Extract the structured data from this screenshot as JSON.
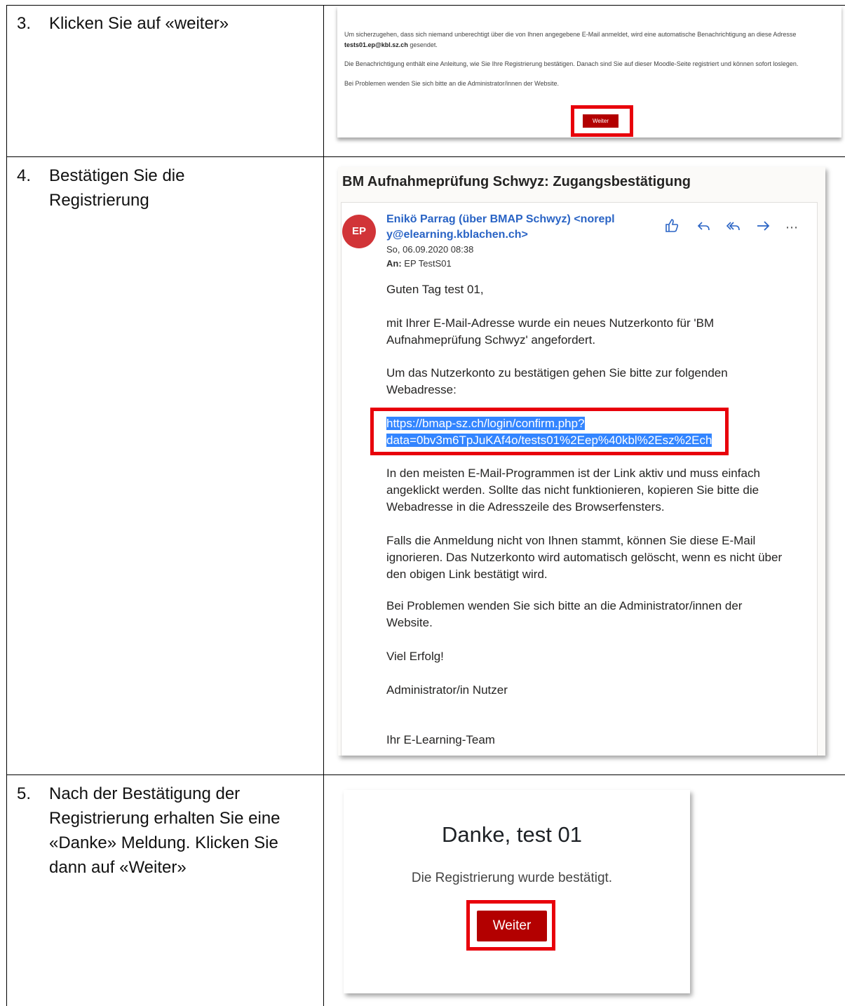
{
  "steps": [
    {
      "number": "3.",
      "text": "Klicken Sie auf «weiter»"
    },
    {
      "number": "4.",
      "text": "Bestätigen Sie die Registrierung"
    },
    {
      "number": "5.",
      "text": "Nach der Bestätigung der Registrierung erhalten Sie eine «Danke» Meldung. Klicken Sie dann auf «Weiter»"
    }
  ],
  "panel1": {
    "line1": "Um sicherzugehen, dass sich niemand unberechtigt über die von Ihnen angegebene E-Mail anmeldet, wird eine automatische Benachrichtigung an diese Adresse",
    "email": "tests01.ep@kbl.sz.ch",
    "line1_suffix": "gesendet.",
    "line2": "Die Benachrichtigung enthält eine Anleitung, wie Sie Ihre Registrierung bestätigen. Danach sind Sie auf dieser Moodle-Seite registriert und können sofort loslegen.",
    "line3": "Bei Problemen wenden Sie sich bitte an die Administrator/innen der Website.",
    "button_label": "Weiter"
  },
  "email": {
    "subject": "BM Aufnahmeprüfung Schwyz: Zugangsbestätigung",
    "avatar_initials": "EP",
    "sender": "Enikö Parrag (über BMAP Schwyz) <noreply@elearning.kblachen.ch>",
    "date": "So, 06.09.2020 08:38",
    "to_label": "An:",
    "to_value": "EP TestS01",
    "greeting": "Guten Tag test 01,",
    "para1": "mit Ihrer E-Mail-Adresse wurde ein neues Nutzerkonto für 'BM Aufnahmeprüfung Schwyz' angefordert.",
    "para2": "Um das Nutzerkonto zu bestätigen gehen Sie bitte zur folgenden Webadresse:",
    "link_line1": "https://bmap-sz.ch/login/confirm.php?",
    "link_line2": "data=0bv3m6TpJuKAf4o/tests01%2Eep%40kbl%2Esz%2Ech",
    "para3": "In den meisten E-Mail-Programmen ist der Link aktiv und muss einfach angeklickt werden. Sollte das nicht funktionieren, kopieren Sie bitte die Webadresse in die Adresszeile des Browserfensters.",
    "para4": "Falls die Anmeldung nicht von Ihnen stammt, können Sie diese E-Mail ignorieren. Das Nutzerkonto wird automatisch gelöscht, wenn es nicht über den obigen Link bestätigt wird.",
    "para5": "Bei Problemen wenden Sie sich bitte an die Administrator/innen der Website.",
    "para6": "Viel Erfolg!",
    "para7": "Administrator/in Nutzer",
    "para8": "Ihr E-Learning-Team",
    "action_icons": [
      "like-icon",
      "reply-icon",
      "reply-all-icon",
      "forward-icon",
      "more-icon"
    ]
  },
  "panel3": {
    "title": "Danke, test 01",
    "subtitle": "Die Registrierung wurde bestätigt.",
    "button_label": "Weiter"
  },
  "colors": {
    "highlight_red": "#e8000b",
    "moodle_button": "#b30000",
    "link_blue": "#2a64c5",
    "selection": "#3385ff"
  }
}
